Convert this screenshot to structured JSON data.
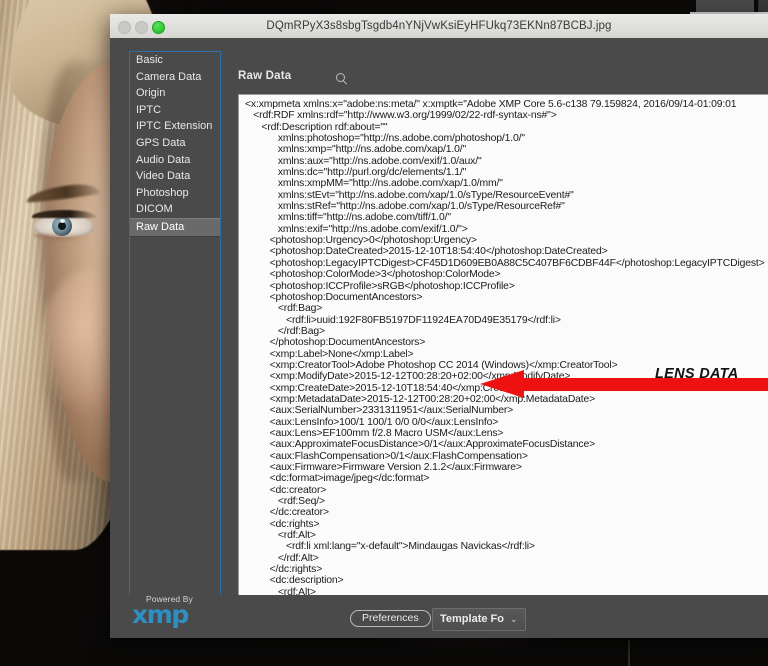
{
  "background": {
    "description": "portrait-photo-of-blonde-woman",
    "fragment_filename": ".jpg"
  },
  "window": {
    "title": "DQmRPyX3s8sbgTsgdb4nYNjVwKsiEyHFUkq73EKNn87BCBJ.jpg",
    "traffic_lights": {
      "close": "close-button",
      "minimize": "minimize-button",
      "zoom": "zoom-button"
    }
  },
  "sidebar": {
    "items": [
      {
        "label": "Basic",
        "selected": false
      },
      {
        "label": "Camera Data",
        "selected": false
      },
      {
        "label": "Origin",
        "selected": false
      },
      {
        "label": "IPTC",
        "selected": false
      },
      {
        "label": "IPTC Extension",
        "selected": false
      },
      {
        "label": "GPS Data",
        "selected": false
      },
      {
        "label": "Audio Data",
        "selected": false
      },
      {
        "label": "Video Data",
        "selected": false
      },
      {
        "label": "Photoshop",
        "selected": false
      },
      {
        "label": "DICOM",
        "selected": false
      },
      {
        "label": "Raw Data",
        "selected": true
      }
    ]
  },
  "panel": {
    "title": "Raw Data",
    "search": {
      "placeholder": "",
      "value": "",
      "icon": "search-icon"
    },
    "raw_text": "<x:xmpmeta xmlns:x=\"adobe:ns:meta/\" x:xmptk=\"Adobe XMP Core 5.6-c138 79.159824, 2016/09/14-01:09:01\n   <rdf:RDF xmlns:rdf=\"http://www.w3.org/1999/02/22-rdf-syntax-ns#\">\n      <rdf:Description rdf:about=\"\"\n            xmlns:photoshop=\"http://ns.adobe.com/photoshop/1.0/\"\n            xmlns:xmp=\"http://ns.adobe.com/xap/1.0/\"\n            xmlns:aux=\"http://ns.adobe.com/exif/1.0/aux/\"\n            xmlns:dc=\"http://purl.org/dc/elements/1.1/\"\n            xmlns:xmpMM=\"http://ns.adobe.com/xap/1.0/mm/\"\n            xmlns:stEvt=\"http://ns.adobe.com/xap/1.0/sType/ResourceEvent#\"\n            xmlns:stRef=\"http://ns.adobe.com/xap/1.0/sType/ResourceRef#\"\n            xmlns:tiff=\"http://ns.adobe.com/tiff/1.0/\"\n            xmlns:exif=\"http://ns.adobe.com/exif/1.0/\">\n         <photoshop:Urgency>0</photoshop:Urgency>\n         <photoshop:DateCreated>2015-12-10T18:54:40</photoshop:DateCreated>\n         <photoshop:LegacyIPTCDigest>CF45D1D609EB0A88C5C407BF6CDBF44F</photoshop:LegacyIPTCDigest>\n         <photoshop:ColorMode>3</photoshop:ColorMode>\n         <photoshop:ICCProfile>sRGB</photoshop:ICCProfile>\n         <photoshop:DocumentAncestors>\n            <rdf:Bag>\n               <rdf:li>uuid:192F80FB5197DF11924EA70D49E35179</rdf:li>\n            </rdf:Bag>\n         </photoshop:DocumentAncestors>\n         <xmp:Label>None</xmp:Label>\n         <xmp:CreatorTool>Adobe Photoshop CC 2014 (Windows)</xmp:CreatorTool>\n         <xmp:ModifyDate>2015-12-12T00:28:20+02:00</xmp:ModifyDate>\n         <xmp:CreateDate>2015-12-10T18:54:40</xmp:CreateDate>\n         <xmp:MetadataDate>2015-12-12T00:28:20+02:00</xmp:MetadataDate>\n         <aux:SerialNumber>2331311951</aux:SerialNumber>\n         <aux:LensInfo>100/1 100/1 0/0 0/0</aux:LensInfo>\n         <aux:Lens>EF100mm f/2.8 Macro USM</aux:Lens>\n         <aux:ApproximateFocusDistance>0/1</aux:ApproximateFocusDistance>\n         <aux:FlashCompensation>0/1</aux:FlashCompensation>\n         <aux:Firmware>Firmware Version 2.1.2</aux:Firmware>\n         <dc:format>image/jpeg</dc:format>\n         <dc:creator>\n            <rdf:Seq/>\n         </dc:creator>\n         <dc:rights>\n            <rdf:Alt>\n               <rdf:li xml:lang=\"x-default\">Mindaugas Navickas</rdf:li>\n            </rdf:Alt>\n         </dc:rights>\n         <dc:description>\n            <rdf:Alt>\n               <rdf:li xml:lang=\"x-default\">fotomindo.eu</rdf:li>\n            </rdf:Alt>"
  },
  "footer": {
    "powered_by": "Powered By",
    "brand": "xmp",
    "preferences_label": "Preferences",
    "template_label": "Template Fo",
    "template_chevron": "⌄"
  },
  "annotation": {
    "label": "LENS DATA",
    "arrow_color": "#ee1111",
    "arrow_direction": "left"
  },
  "colors": {
    "dialog_bg": "#4a4a4a",
    "sidebar_border": "#2f6fa8",
    "selected_row": "#6a6a6a",
    "text_area_bg": "#fbfbfb",
    "brand_blue": "#2e8fc4",
    "titlebar": "#dedede",
    "zoom_green": "#21b721"
  }
}
